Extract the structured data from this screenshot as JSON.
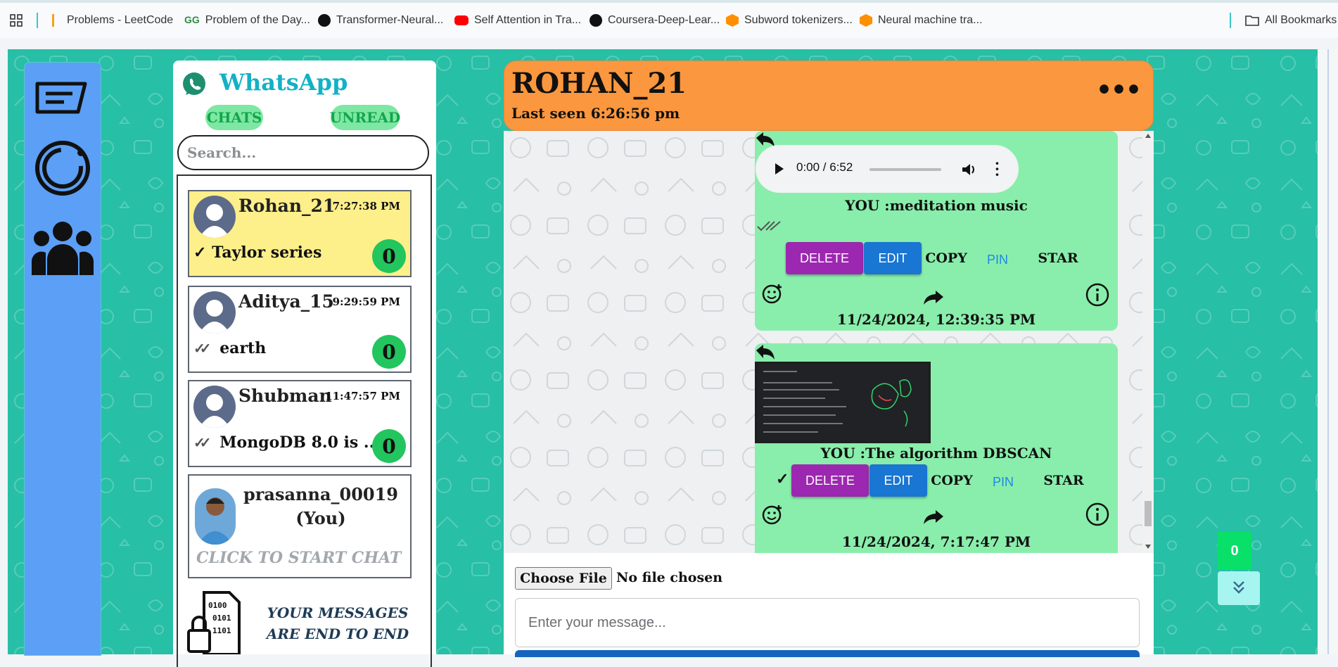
{
  "bookmarks": [
    {
      "label": "Problems - LeetCode",
      "icon": "leetcode-icon",
      "color": "#f89f1b"
    },
    {
      "label": "Problem of the Day...",
      "icon": "gfg-icon",
      "color": "#2f8d46"
    },
    {
      "label": "Transformer-Neural...",
      "icon": "github-icon",
      "color": "#111111"
    },
    {
      "label": "Self Attention in Tra...",
      "icon": "youtube-icon",
      "color": "#ff0000"
    },
    {
      "label": "Coursera-Deep-Lear...",
      "icon": "github-icon",
      "color": "#111111"
    },
    {
      "label": "Subword tokenizers...",
      "icon": "tensorflow-icon",
      "color": "#ff8f00"
    },
    {
      "label": "Neural machine tra...",
      "icon": "tensorflow-icon",
      "color": "#ff8f00"
    }
  ],
  "all_bookmarks": "All Bookmarks",
  "app": {
    "title": "WhatsApp",
    "tab_chats": "CHATS",
    "tab_unread": "UNREAD",
    "search_placeholder": "Search..."
  },
  "chat_list": [
    {
      "name": "Rohan_21",
      "time": "7:27:38 PM",
      "last": "Taylor series",
      "status": "sent-check",
      "unread": "0",
      "highlight": "#fdef8a"
    },
    {
      "name": "Aditya_15",
      "time": "9:29:59 PM",
      "last": "earth",
      "status": "double-check",
      "unread": "0"
    },
    {
      "name": "Shubman",
      "time": "11:47:57 PM",
      "last": "MongoDB 8.0 is ...",
      "status": "double-check",
      "unread": "0"
    }
  ],
  "self_card": {
    "name_line1": "prasanna_00019",
    "name_line2": "(You)",
    "cta": "CLICK TO START CHAT"
  },
  "e2e_notice": "YOUR MESSAGES ARE END TO END",
  "chat": {
    "name": "ROHAN_21",
    "last_seen": "Last seen 6:26:56 pm",
    "messages": [
      {
        "audio_time": "0:00 / 6:52",
        "text": "YOU :meditation music",
        "date": "11/24/2024, 12:39:35 PM"
      },
      {
        "text": "YOU :The algorithm DBSCAN",
        "date": "11/24/2024, 7:17:47 PM",
        "status_mark": "✓"
      }
    ],
    "actions": {
      "delete": "DELETE",
      "edit": "EDIT",
      "copy": "COPY",
      "pin": "PIN",
      "star": "STAR"
    },
    "file_button": "Choose File",
    "file_status": "No file chosen",
    "input_placeholder": "Enter your message..."
  },
  "unread_counter": "0",
  "colors": {
    "teal_bg": "#27bfa6",
    "nav_blue": "#5b9ff6",
    "header_orange": "#fb973e",
    "bubble_green": "#89eeab",
    "badge_green": "#22c55e",
    "delete_purple": "#9c27b0",
    "edit_blue": "#1976d2",
    "selected_card": "#fdef8a"
  }
}
